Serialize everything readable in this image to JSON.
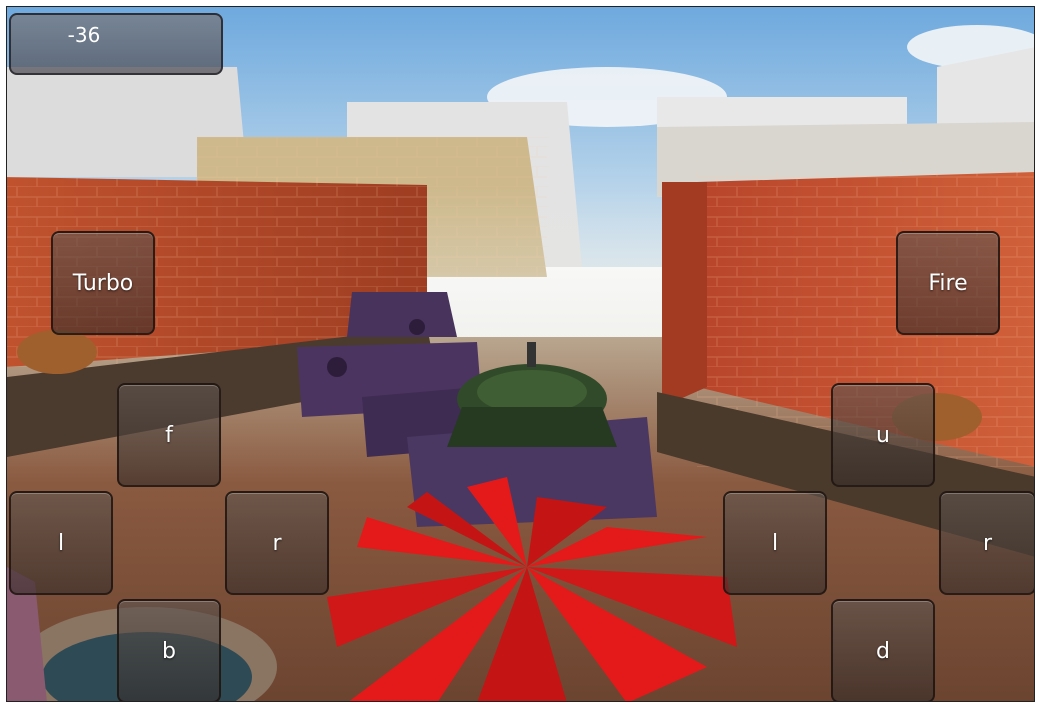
{
  "hud": {
    "score": "-36",
    "turbo_label": "Turbo",
    "fire_label": "Fire"
  },
  "left_pad": {
    "forward_label": "f",
    "left_label": "l",
    "right_label": "r",
    "back_label": "b"
  },
  "right_pad": {
    "up_label": "u",
    "left_label": "l",
    "right_label": "r",
    "down_label": "d"
  },
  "colors": {
    "sky": "#8fc0e6",
    "brick": "#c4512c",
    "ground": "#7a5038",
    "player_tank": "#e01a1a",
    "enemy_tank": "#4b3560"
  }
}
